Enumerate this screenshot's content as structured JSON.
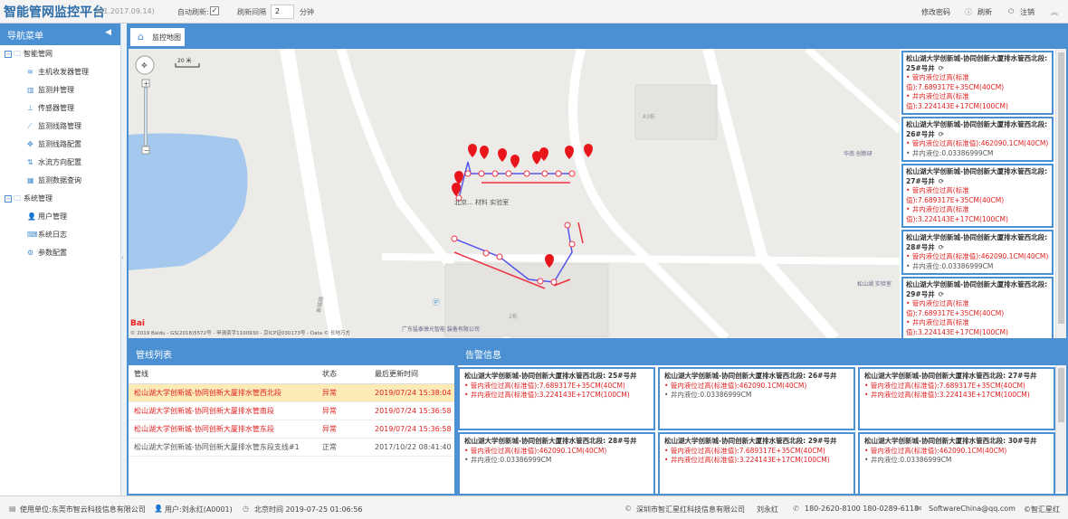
{
  "header": {
    "title": "智能管网监控平台",
    "date": "(01.2017.09.14)",
    "auto_refresh_label": "自动刷新:",
    "interval_label": "刷新间隔",
    "interval_value": "2",
    "interval_unit": "分钟",
    "change_pw": "修改密码",
    "refresh": "刷新",
    "logout": "注销"
  },
  "sidebar": {
    "title": "导航菜单",
    "groups": [
      {
        "label": "智能管网",
        "items": [
          "主机收发器管理",
          "监测井管理",
          "传感器管理",
          "监测线路管理",
          "监测线路配置",
          "水流方向配置",
          "监测数据查询"
        ]
      },
      {
        "label": "系统管理",
        "items": [
          "用户管理",
          "系统日志",
          "参数配置"
        ]
      }
    ]
  },
  "tab": {
    "label": "监控地图"
  },
  "map": {
    "scale": "20 米",
    "copyright": "© 2019 Baidu - GS(2018)5572号 - 甲测资字1100930 - 京ICP证030173号 - Data © 长地万方",
    "labels": {
      "lab": "北京... 材料 实验室",
      "a3": "A3栋",
      "huanan": "华南 创新研",
      "songshan": "松山湖 实验室",
      "guangdong": "广东猛泰激光智能 装备有限公司",
      "road": "新城路",
      "b2": "2栋"
    }
  },
  "alarm_side": [
    {
      "title": "松山湖大学创新城-协同创新大厦排水管西北段: 25#号井",
      "lines": [
        {
          "t": "管内液位过高(标准值):7.689317E+35CM(40CM)",
          "c": "red"
        },
        {
          "t": "井内液位过高(标准值):3.224143E+17CM(100CM)",
          "c": "red"
        }
      ]
    },
    {
      "title": "松山湖大学创新城-协同创新大厦排水管西北段: 26#号井",
      "lines": [
        {
          "t": "管内液位过高(标准值):462090.1CM(40CM)",
          "c": "red"
        },
        {
          "t": "井内液位:0.03386999CM",
          "c": "gray"
        }
      ]
    },
    {
      "title": "松山湖大学创新城-协同创新大厦排水管西北段: 27#号井",
      "lines": [
        {
          "t": "管内液位过高(标准值):7.689317E+35CM(40CM)",
          "c": "red"
        },
        {
          "t": "井内液位过高(标准值):3.224143E+17CM(100CM)",
          "c": "red"
        }
      ]
    },
    {
      "title": "松山湖大学创新城-协同创新大厦排水管西北段: 28#号井",
      "lines": [
        {
          "t": "管内液位过高(标准值):462090.1CM(40CM)",
          "c": "red"
        },
        {
          "t": "井内液位:0.03386999CM",
          "c": "gray"
        }
      ]
    },
    {
      "title": "松山湖大学创新城-协同创新大厦排水管西北段: 29#号井",
      "lines": [
        {
          "t": "管内液位过高(标准值):7.689317E+35CM(40CM)",
          "c": "red"
        },
        {
          "t": "井内液位过高(标准值):3.224143E+17CM(100CM)",
          "c": "red"
        }
      ]
    }
  ],
  "pipelines": {
    "title": "管线列表",
    "headers": [
      "管线",
      "状态",
      "最后更新时间"
    ],
    "rows": [
      {
        "name": "松山湖大学创新城-协同创新大厦排水管西北段",
        "status": "异常",
        "time": "2019/07/24 15:38:04"
      },
      {
        "name": "松山湖大学创新城-协同创新大厦排水管南段",
        "status": "异常",
        "time": "2019/07/24 15:36:58"
      },
      {
        "name": "松山湖大学创新城-协同创新大厦排水管东段",
        "status": "异常",
        "time": "2019/07/24 15:36:58"
      },
      {
        "name": "松山湖大学创新城-协同创新大厦排水管东段支线#1",
        "status": "正常",
        "time": "2017/10/22 08:41:40"
      }
    ]
  },
  "alarms": {
    "title": "告警信息",
    "cards": [
      {
        "title": "松山湖大学创新城-协同创新大厦排水管西北段: 25#号井",
        "lines": [
          {
            "t": "管内液位过高(标准值):7.689317E+35CM(40CM)",
            "c": "red"
          },
          {
            "t": "井内液位过高(标准值):3.224143E+17CM(100CM)",
            "c": "red"
          }
        ]
      },
      {
        "title": "松山湖大学创新城-协同创新大厦排水管西北段: 26#号井",
        "lines": [
          {
            "t": "管内液位过高(标准值):462090.1CM(40CM)",
            "c": "red"
          },
          {
            "t": "井内液位:0.03386999CM",
            "c": "gray"
          }
        ]
      },
      {
        "title": "松山湖大学创新城-协同创新大厦排水管西北段: 27#号井",
        "lines": [
          {
            "t": "管内液位过高(标准值):7.689317E+35CM(40CM)",
            "c": "red"
          },
          {
            "t": "井内液位过高(标准值):3.224143E+17CM(100CM)",
            "c": "red"
          }
        ]
      },
      {
        "title": "松山湖大学创新城-协同创新大厦排水管西北段: 28#号井",
        "lines": [
          {
            "t": "管内液位过高(标准值):462090.1CM(40CM)",
            "c": "red"
          },
          {
            "t": "井内液位:0.03386999CM",
            "c": "gray"
          }
        ]
      },
      {
        "title": "松山湖大学创新城-协同创新大厦排水管西北段: 29#号井",
        "lines": [
          {
            "t": "管内液位过高(标准值):7.689317E+35CM(40CM)",
            "c": "red"
          },
          {
            "t": "井内液位过高(标准值):3.224143E+17CM(100CM)",
            "c": "red"
          }
        ]
      },
      {
        "title": "松山湖大学创新城-协同创新大厦排水管西北段: 30#号井",
        "lines": [
          {
            "t": "管内液位过高(标准值):462090.1CM(40CM)",
            "c": "red"
          },
          {
            "t": "井内液位:0.03386999CM",
            "c": "gray"
          }
        ]
      }
    ]
  },
  "footer": {
    "unit": "使用单位:东莞市智云科技信息有限公司",
    "user": "用户:刘永红(A0001)",
    "time": "北京时间 2019-07-25 01:06:56",
    "company": "深圳市智汇星红科技信息有限公司",
    "contact": "刘永红",
    "phone": "180-2620-8100 180-0289-6118",
    "email": "SoftwareChina@qq.com",
    "brand": "©智汇星红"
  },
  "colors": {
    "accent": "#4a90d2",
    "alert": "#e02020"
  }
}
